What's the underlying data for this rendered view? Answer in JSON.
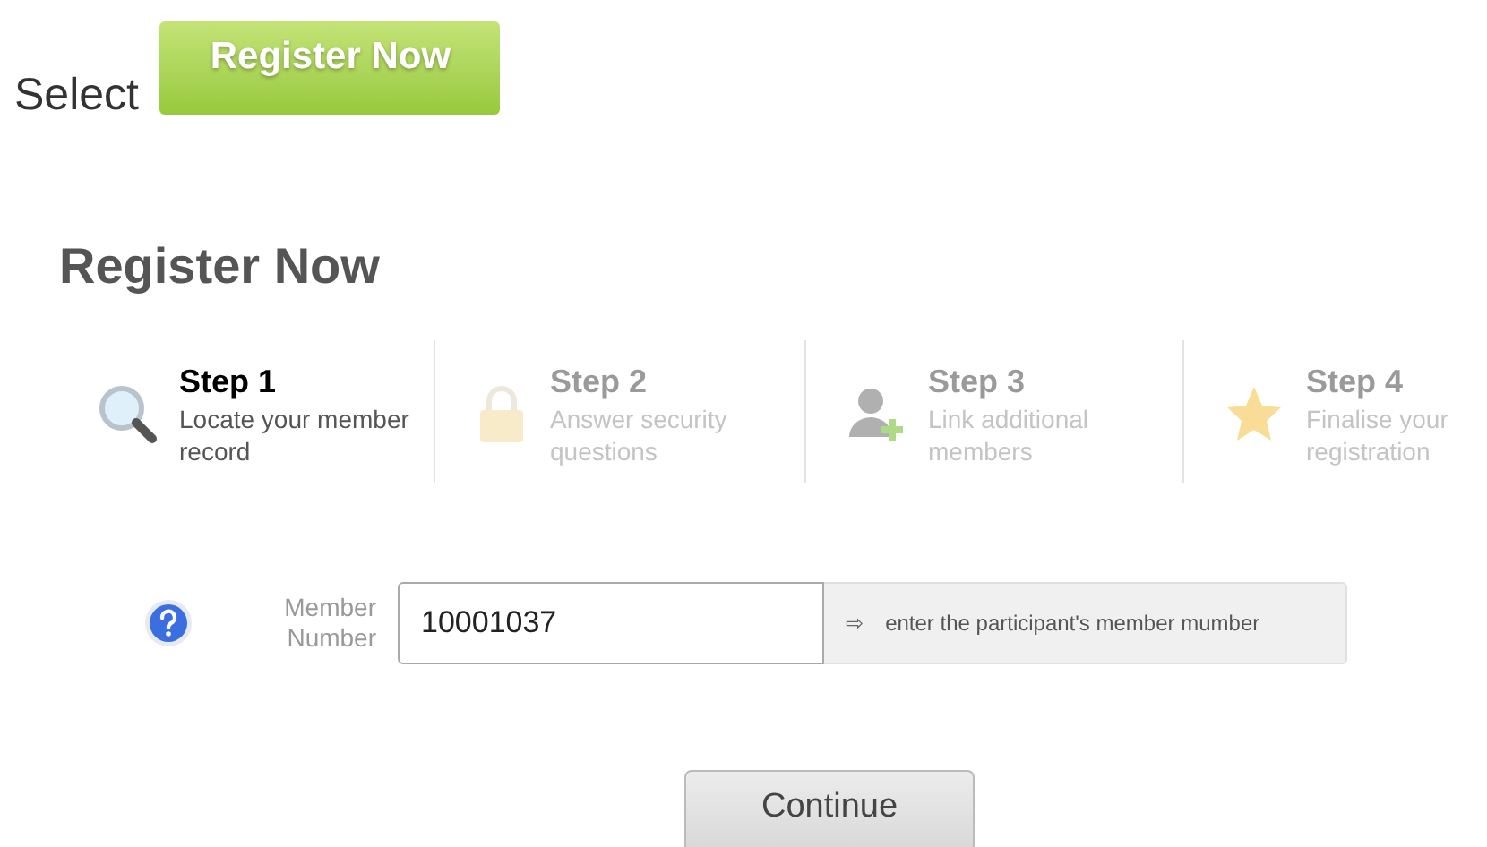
{
  "intro": {
    "text": "Select",
    "button": "Register Now"
  },
  "heading": "Register Now",
  "steps": [
    {
      "kind": "search",
      "title": "Step 1",
      "description": "Locate your member record",
      "selected": true
    },
    {
      "kind": "lock",
      "title": "Step 2",
      "description": "Answer security questions",
      "selected": false
    },
    {
      "kind": "user-add",
      "title": "Step 3",
      "description": "Link additional members",
      "selected": false
    },
    {
      "kind": "star",
      "title": "Step 4",
      "description": "Finalise your registration",
      "selected": false
    }
  ],
  "member_field": {
    "label": "Member Number",
    "value": "10001037",
    "hint_arrow": "⇨",
    "hint": "enter the participant's member mumber"
  },
  "continue_button": "Continue"
}
